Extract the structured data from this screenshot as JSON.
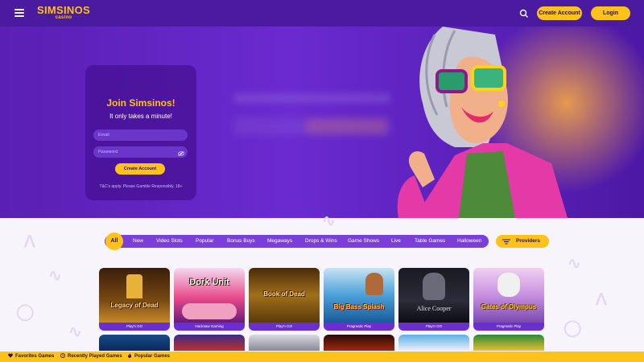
{
  "header": {
    "logo": "SIMSINOS",
    "logo_sub": "casino",
    "create_account": "Create Account",
    "login": "Login"
  },
  "join": {
    "title": "Join Simsinos!",
    "subtitle": "It only takes a minute!",
    "email_placeholder": "Email",
    "password_placeholder": "Password",
    "create_button": "Create Account",
    "terms": "T&C's apply. Please Gamble Responsibly. 18+"
  },
  "categories": {
    "all": "All",
    "items": [
      "New",
      "Video Slots",
      "Popular",
      "Bonus Buys",
      "Megaways",
      "Drops & Wins",
      "Game Shows",
      "Live",
      "Table Games",
      "Halloween"
    ],
    "providers": "Providers"
  },
  "games": [
    {
      "title": "Legacy of Dead",
      "provider": "Play'n GO"
    },
    {
      "title": "Dork Unit",
      "provider": "Hacksaw Gaming"
    },
    {
      "title": "Book of Dead",
      "provider": "Play'n GO"
    },
    {
      "title": "Big Bass Splash",
      "provider": "Pragmatic Play"
    },
    {
      "title": "Alice Cooper",
      "provider": "Play'n GO"
    },
    {
      "title": "Gates of Olympus",
      "provider": "Pragmatic Play"
    }
  ],
  "bottom_bar": {
    "favorites": "Favorites Games",
    "recent": "Recently Played Games",
    "popular": "Popular Games"
  },
  "colors": {
    "brand_purple": "#4a1aa0",
    "accent_yellow": "#ffc21a"
  }
}
